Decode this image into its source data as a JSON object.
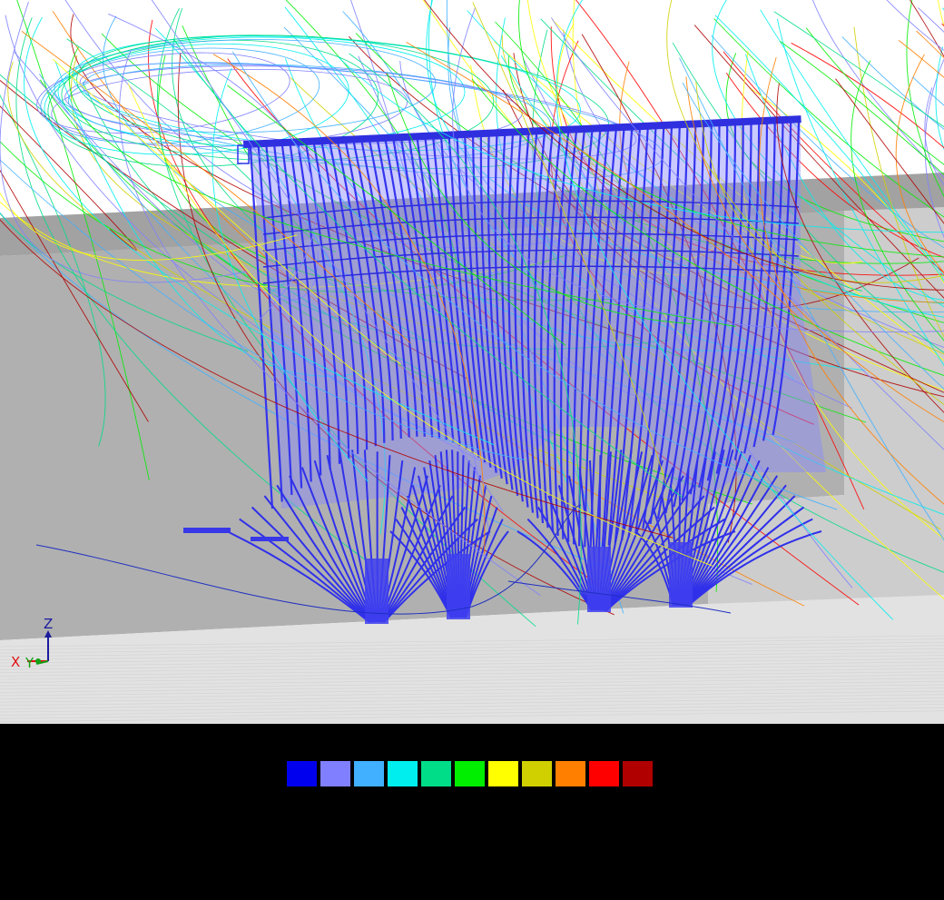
{
  "viewport": {
    "background_colors": {
      "sky": "#ffffff",
      "back_wall": "#a5a5a5",
      "side_wall": "#c9c9c9",
      "floor": "#e0e0e0",
      "structure": "#3a3ae8"
    },
    "triad": {
      "z_label": "Z",
      "x_label": "X",
      "y_label": "Y",
      "z_color": "#1b1b9e",
      "x_color": "#e01010",
      "y_color": "#15a015"
    }
  },
  "legend": {
    "colors": [
      "#0000ee",
      "#7f7fff",
      "#40b0ff",
      "#00eeee",
      "#00dd88",
      "#00ee00",
      "#ffff00",
      "#d0d000",
      "#ff8000",
      "#ff0000",
      "#b00000"
    ]
  }
}
